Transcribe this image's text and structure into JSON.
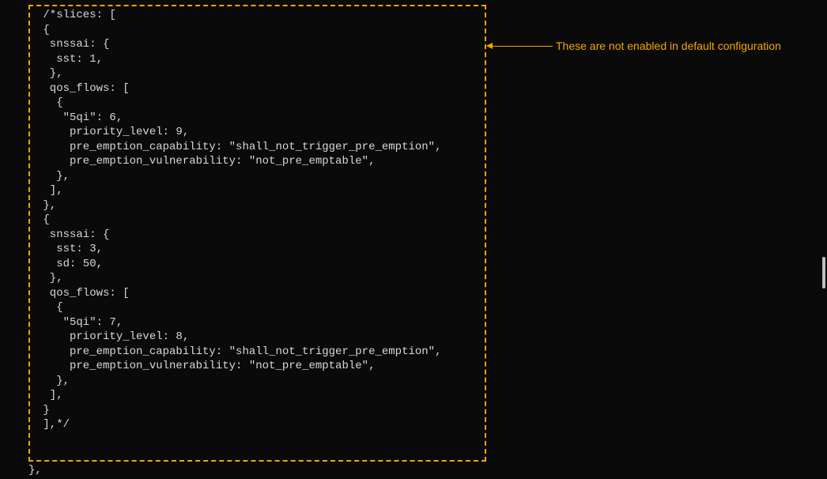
{
  "annotation": "These are not enabled in default configuration",
  "trailing": "},",
  "code_lines": [
    " /*slices: [",
    " {",
    "  snssai: {",
    "   sst: 1,",
    "  },",
    "  qos_flows: [",
    "   {",
    "    \"5qi\": 6,",
    "     priority_level: 9,",
    "     pre_emption_capability: \"shall_not_trigger_pre_emption\",",
    "     pre_emption_vulnerability: \"not_pre_emptable\",",
    "   },",
    "  ],",
    " },",
    " {",
    "  snssai: {",
    "   sst: 3,",
    "   sd: 50,",
    "  },",
    "  qos_flows: [",
    "   {",
    "    \"5qi\": 7,",
    "     priority_level: 8,",
    "     pre_emption_capability: \"shall_not_trigger_pre_emption\",",
    "     pre_emption_vulnerability: \"not_pre_emptable\",",
    "   },",
    "  ],",
    " }",
    " ],*/"
  ]
}
